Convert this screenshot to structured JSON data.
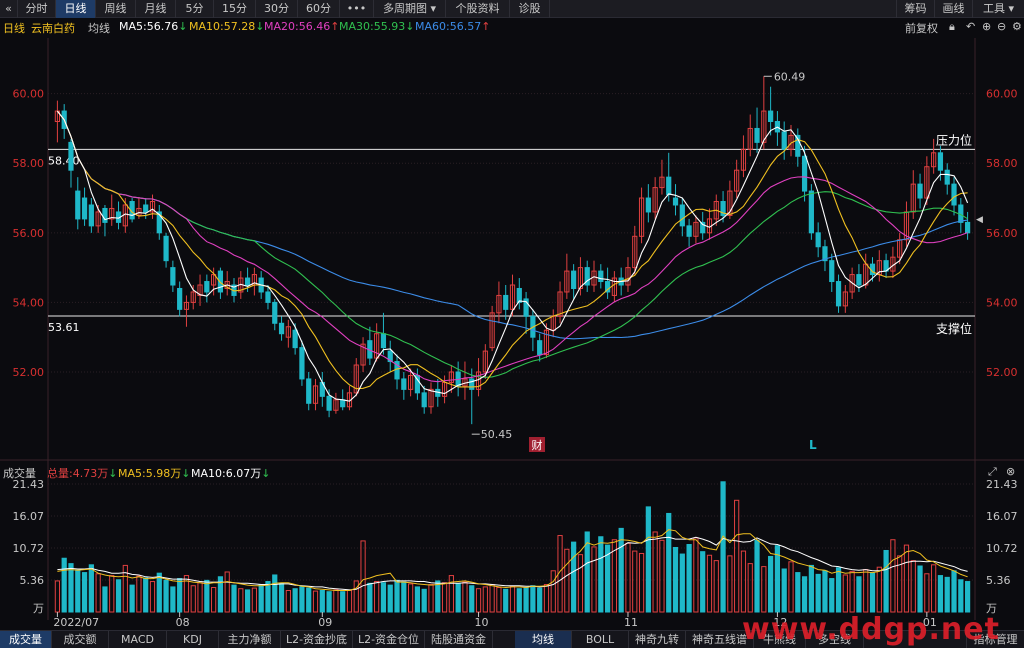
{
  "toolbar": {
    "collapse_icon": "«",
    "periods": [
      "分时",
      "日线",
      "周线",
      "月线",
      "5分",
      "15分",
      "30分",
      "60分",
      "•••",
      "多周期图 ▾",
      "个股资料",
      "诊股"
    ],
    "right": [
      "筹码",
      "画线",
      "工具 ▾"
    ]
  },
  "info": {
    "period": "日线",
    "stock_name": "云南白药",
    "indicator": "均线",
    "ma5": "MA5:56.76",
    "ma5_arrow": "↓",
    "ma10": "MA10:57.28",
    "ma10_arrow": "↓",
    "ma20": "MA20:56.46",
    "ma20_arrow": "↑",
    "ma30": "MA30:55.93",
    "ma30_arrow": "↓",
    "ma60": "MA60:56.57",
    "ma60_arrow": "↑",
    "adjust": "前复权"
  },
  "colors": {
    "up": "#e04040",
    "down": "#1fb8c8",
    "ma5": "#ffffff",
    "ma10": "#f0c020",
    "ma20": "#e040c0",
    "ma30": "#30c050",
    "ma60": "#3c8ce8",
    "axis_text": "#d83030",
    "grid": "#2a1f24"
  },
  "chart_data": [
    {
      "type": "candlestick",
      "title": "日线 云南白药",
      "y_ticks": [
        "60.00",
        "58.00",
        "56.00",
        "54.00",
        "52.00"
      ],
      "ylim": [
        49.7,
        61.6
      ],
      "x_labels": [
        "2022/07",
        "08",
        "09",
        "10",
        "11",
        "12",
        "01",
        "02"
      ],
      "annotations": {
        "high": "60.49",
        "low": "50.45",
        "resistance_value": "58.40",
        "resistance_label": "压力位",
        "support_value": "53.61",
        "support_label": "支撑位",
        "event_marker": "财",
        "l_marker": "L"
      },
      "candles": [
        [
          59.2,
          59.5,
          59.8,
          58.6
        ],
        [
          59.5,
          59.0,
          59.7,
          58.7
        ],
        [
          58.6,
          57.8,
          58.7,
          57.3
        ],
        [
          57.2,
          56.4,
          57.6,
          56.1
        ],
        [
          57.0,
          56.4,
          57.3,
          56.2
        ],
        [
          56.8,
          56.2,
          57.0,
          56.0
        ],
        [
          56.2,
          56.6,
          56.8,
          56.0
        ],
        [
          56.7,
          56.3,
          56.8,
          55.9
        ],
        [
          56.4,
          56.7,
          57.1,
          56.2
        ],
        [
          56.6,
          56.3,
          56.9,
          56.1
        ],
        [
          56.2,
          56.8,
          57.0,
          56.0
        ],
        [
          56.9,
          56.4,
          57.0,
          56.3
        ],
        [
          56.5,
          56.7,
          57.0,
          56.4
        ],
        [
          56.8,
          56.6,
          57.0,
          56.4
        ],
        [
          56.6,
          56.9,
          57.1,
          56.4
        ],
        [
          56.6,
          56.0,
          56.8,
          55.8
        ],
        [
          55.9,
          55.2,
          56.0,
          55.0
        ],
        [
          55.0,
          54.5,
          55.2,
          54.3
        ],
        [
          54.4,
          53.8,
          54.6,
          53.6
        ],
        [
          53.8,
          54.0,
          54.2,
          53.3
        ],
        [
          54.0,
          54.3,
          54.5,
          53.8
        ],
        [
          54.2,
          54.5,
          54.8,
          53.9
        ],
        [
          54.6,
          54.3,
          54.8,
          54.0
        ],
        [
          54.5,
          54.8,
          55.0,
          54.2
        ],
        [
          54.9,
          54.3,
          55.0,
          54.1
        ],
        [
          54.4,
          54.6,
          54.9,
          54.2
        ],
        [
          54.5,
          54.2,
          54.7,
          54.0
        ],
        [
          54.3,
          54.7,
          54.9,
          54.1
        ],
        [
          54.7,
          54.5,
          55.0,
          54.3
        ],
        [
          54.5,
          54.8,
          55.0,
          54.2
        ],
        [
          54.7,
          54.3,
          54.9,
          54.1
        ],
        [
          54.3,
          54.0,
          54.5,
          53.8
        ],
        [
          54.0,
          53.4,
          54.1,
          53.2
        ],
        [
          53.4,
          53.1,
          53.6,
          52.9
        ],
        [
          53.0,
          53.3,
          53.5,
          52.7
        ],
        [
          53.2,
          52.7,
          53.4,
          52.5
        ],
        [
          52.7,
          51.8,
          52.9,
          51.6
        ],
        [
          51.8,
          51.1,
          52.0,
          50.9
        ],
        [
          51.1,
          51.6,
          51.8,
          50.9
        ],
        [
          51.7,
          51.3,
          52.0,
          51.0
        ],
        [
          51.3,
          50.9,
          51.5,
          50.7
        ],
        [
          50.9,
          51.2,
          51.4,
          50.8
        ],
        [
          51.2,
          51.0,
          51.5,
          50.9
        ],
        [
          51.0,
          51.4,
          51.6,
          50.9
        ],
        [
          51.4,
          52.2,
          52.4,
          51.3
        ],
        [
          52.2,
          52.8,
          53.0,
          52.0
        ],
        [
          52.9,
          52.4,
          53.3,
          52.2
        ],
        [
          52.4,
          53.1,
          53.4,
          52.3
        ],
        [
          53.1,
          52.7,
          53.7,
          52.5
        ],
        [
          52.6,
          52.3,
          52.9,
          52.0
        ],
        [
          52.3,
          51.8,
          52.5,
          51.5
        ],
        [
          51.8,
          51.5,
          52.0,
          51.2
        ],
        [
          51.5,
          51.9,
          52.1,
          51.3
        ],
        [
          51.9,
          51.4,
          52.1,
          51.2
        ],
        [
          51.4,
          51.0,
          51.6,
          50.8
        ],
        [
          51.0,
          51.5,
          51.7,
          50.8
        ],
        [
          51.5,
          51.3,
          51.8,
          51.0
        ],
        [
          51.3,
          51.7,
          51.9,
          51.1
        ],
        [
          51.7,
          52.0,
          52.2,
          51.4
        ],
        [
          52.0,
          51.6,
          52.3,
          51.3
        ],
        [
          51.6,
          51.8,
          52.3,
          51.2
        ],
        [
          51.8,
          51.5,
          52.1,
          50.5
        ],
        [
          51.5,
          52.0,
          52.4,
          51.3
        ],
        [
          52.0,
          52.6,
          52.8,
          51.8
        ],
        [
          52.7,
          53.7,
          53.9,
          52.6
        ],
        [
          53.7,
          54.2,
          54.6,
          53.4
        ],
        [
          54.2,
          53.8,
          54.5,
          53.5
        ],
        [
          53.8,
          54.5,
          54.8,
          53.6
        ],
        [
          54.4,
          54.0,
          54.7,
          53.8
        ],
        [
          54.1,
          53.6,
          54.3,
          53.1
        ],
        [
          53.6,
          53.0,
          53.8,
          52.6
        ],
        [
          52.9,
          52.5,
          53.1,
          52.3
        ],
        [
          52.5,
          53.2,
          53.4,
          52.4
        ],
        [
          53.2,
          53.6,
          53.8,
          53.0
        ],
        [
          53.6,
          54.3,
          54.6,
          53.4
        ],
        [
          54.3,
          54.9,
          55.4,
          54.1
        ],
        [
          54.9,
          54.4,
          55.1,
          54.1
        ],
        [
          54.4,
          55.0,
          55.3,
          54.2
        ],
        [
          55.0,
          54.5,
          55.2,
          54.3
        ],
        [
          54.5,
          54.9,
          55.2,
          54.3
        ],
        [
          54.9,
          54.6,
          55.1,
          54.4
        ],
        [
          54.6,
          54.3,
          55.0,
          54.1
        ],
        [
          54.2,
          54.7,
          54.9,
          54.0
        ],
        [
          54.7,
          54.5,
          55.0,
          54.2
        ],
        [
          54.5,
          55.0,
          55.3,
          54.3
        ],
        [
          55.0,
          55.9,
          56.2,
          54.8
        ],
        [
          55.9,
          57.0,
          57.3,
          55.7
        ],
        [
          57.0,
          56.6,
          57.4,
          56.3
        ],
        [
          56.6,
          57.3,
          57.6,
          56.4
        ],
        [
          57.3,
          57.6,
          58.1,
          57.1
        ],
        [
          57.6,
          57.1,
          58.3,
          56.9
        ],
        [
          57.0,
          56.8,
          57.4,
          56.5
        ],
        [
          56.8,
          56.2,
          57.0,
          55.9
        ],
        [
          56.2,
          55.9,
          56.4,
          55.6
        ],
        [
          55.9,
          56.3,
          56.5,
          55.7
        ],
        [
          56.3,
          56.0,
          56.6,
          55.8
        ],
        [
          56.0,
          56.4,
          56.7,
          55.8
        ],
        [
          56.4,
          56.9,
          57.1,
          56.2
        ],
        [
          56.9,
          56.5,
          57.2,
          56.3
        ],
        [
          56.5,
          57.2,
          57.5,
          56.4
        ],
        [
          57.2,
          57.8,
          58.1,
          57.0
        ],
        [
          57.8,
          58.4,
          58.8,
          57.6
        ],
        [
          58.4,
          59.0,
          59.4,
          58.2
        ],
        [
          59.0,
          58.6,
          59.6,
          58.3
        ],
        [
          58.6,
          59.5,
          60.5,
          58.4
        ],
        [
          59.5,
          59.2,
          60.2,
          58.8
        ],
        [
          59.2,
          58.9,
          59.5,
          58.5
        ],
        [
          58.9,
          58.4,
          59.2,
          58.1
        ],
        [
          58.4,
          58.8,
          59.1,
          58.2
        ],
        [
          58.8,
          58.2,
          59.0,
          57.9
        ],
        [
          58.2,
          57.2,
          58.5,
          56.9
        ],
        [
          57.2,
          56.0,
          57.4,
          55.8
        ],
        [
          56.0,
          55.6,
          56.3,
          55.3
        ],
        [
          55.6,
          55.2,
          55.8,
          54.9
        ],
        [
          55.2,
          54.6,
          55.4,
          54.3
        ],
        [
          54.6,
          53.9,
          54.8,
          53.7
        ],
        [
          53.9,
          54.3,
          54.5,
          53.7
        ],
        [
          54.3,
          54.8,
          55.0,
          54.1
        ],
        [
          54.8,
          54.5,
          55.1,
          54.3
        ],
        [
          54.5,
          55.1,
          55.4,
          54.4
        ],
        [
          55.1,
          54.8,
          55.3,
          54.6
        ],
        [
          54.8,
          55.2,
          55.5,
          54.6
        ],
        [
          55.2,
          54.9,
          55.4,
          54.7
        ],
        [
          54.9,
          55.3,
          55.6,
          54.7
        ],
        [
          55.3,
          55.8,
          56.0,
          55.1
        ],
        [
          55.8,
          56.6,
          56.9,
          55.6
        ],
        [
          56.6,
          57.4,
          57.8,
          56.4
        ],
        [
          57.4,
          57.0,
          57.7,
          56.7
        ],
        [
          57.0,
          57.9,
          58.2,
          56.8
        ],
        [
          57.9,
          58.3,
          58.7,
          57.7
        ],
        [
          58.3,
          57.8,
          58.5,
          57.5
        ],
        [
          57.8,
          57.4,
          58.0,
          57.1
        ],
        [
          57.4,
          56.8,
          57.6,
          56.5
        ],
        [
          56.8,
          56.3,
          57.0,
          56.0
        ],
        [
          56.3,
          56.0,
          56.6,
          55.8
        ]
      ]
    },
    {
      "type": "bar",
      "title": "成交量",
      "y_ticks": [
        "21.43",
        "16.07",
        "10.72",
        "5.36",
        "万"
      ],
      "ylim": [
        0,
        21.43
      ],
      "legend": {
        "total_label": "总量:4.73万",
        "total_arrow": "↓",
        "ma5_label": "MA5:5.98万",
        "ma5_arrow": "↓",
        "ma10_label": "MA10:6.07万",
        "ma10_arrow": "↓"
      },
      "values": [
        5.2,
        9.0,
        8.1,
        7.0,
        6.6,
        7.9,
        6.4,
        4.2,
        6.1,
        5.4,
        7.8,
        4.5,
        6.0,
        5.7,
        5.1,
        6.5,
        5.3,
        4.2,
        5.6,
        6.1,
        4.4,
        4.9,
        5.3,
        4.1,
        5.9,
        6.7,
        4.5,
        3.9,
        3.7,
        4.0,
        4.6,
        5.1,
        6.2,
        4.8,
        3.6,
        3.9,
        4.2,
        4.0,
        3.5,
        3.6,
        3.4,
        3.7,
        3.4,
        3.6,
        5.2,
        11.9,
        4.8,
        5.1,
        4.9,
        4.5,
        5.3,
        5.0,
        4.7,
        4.2,
        3.8,
        4.6,
        5.2,
        4.9,
        6.1,
        4.7,
        5.0,
        4.4,
        3.9,
        4.2,
        4.6,
        4.1,
        3.8,
        4.3,
        3.9,
        4.1,
        4.4,
        4.0,
        4.6,
        6.9,
        12.8,
        10.5,
        11.7,
        9.6,
        13.4,
        10.9,
        12.6,
        11.2,
        12.1,
        14.0,
        11.5,
        10.2,
        9.8,
        17.6,
        13.4,
        12.0,
        16.5,
        10.8,
        9.7,
        11.3,
        12.4,
        10.1,
        9.5,
        8.6,
        21.8,
        9.4,
        18.7,
        10.2,
        8.1,
        12.0,
        7.6,
        9.3,
        11.1,
        7.2,
        8.4,
        6.6,
        5.9,
        7.8,
        6.3,
        6.9,
        5.6,
        7.4,
        6.2,
        6.8,
        5.9,
        7.1,
        6.5,
        7.5,
        10.3,
        12.1,
        9.4,
        11.2,
        8.6,
        7.7,
        6.4,
        7.9,
        6.1,
        5.8,
        6.9,
        5.4,
        5.1,
        4.8,
        6.0,
        5.2,
        4.6,
        4.2,
        4.9,
        4.7,
        5.3,
        4.1,
        4.5,
        5.0,
        6.4,
        5.8,
        5.5,
        6.8,
        11.6,
        7.2,
        6.5,
        5.9,
        6.1,
        7.0,
        4.7
      ],
      "ma5": [
        6.8,
        7.0,
        7.1,
        7.0,
        7.1,
        7.2,
        6.5,
        6.2,
        6.0,
        5.9,
        6.0,
        5.7,
        5.9,
        5.6,
        5.6,
        5.8,
        5.5,
        5.2,
        5.1,
        5.2,
        5.0,
        4.9,
        4.7,
        4.9,
        4.9,
        5.1,
        4.9,
        4.7,
        4.5,
        4.4,
        4.4,
        4.5,
        4.8,
        4.9,
        4.9,
        4.6,
        4.3,
        4.2,
        3.9,
        3.8,
        3.7,
        3.6,
        3.6,
        3.6,
        4.0,
        5.4,
        5.7,
        6.1,
        6.3,
        6.5,
        5.0,
        5.0,
        4.9,
        4.7,
        4.6,
        4.5,
        4.6,
        4.7,
        5.0,
        5.1,
        5.2,
        5.0,
        4.7,
        4.6,
        4.4,
        4.2,
        4.1,
        4.2,
        4.2,
        4.1,
        4.3,
        4.3,
        4.4,
        5.1,
        6.8,
        8.0,
        9.2,
        10.2,
        11.6,
        11.2,
        11.6,
        11.5,
        11.7,
        12.1,
        12.0,
        11.8,
        11.5,
        12.5,
        12.5,
        12.8,
        13.8,
        13.6,
        12.5,
        12.1,
        12.1,
        10.9,
        10.6,
        10.4,
        12.7,
        11.6,
        12.9,
        13.1,
        13.1,
        12.1,
        11.2,
        9.8,
        9.6,
        9.2,
        8.7,
        8.2,
        7.9,
        7.6,
        7.1,
        7.0,
        6.5,
        6.8,
        6.5,
        6.6,
        6.6,
        6.7,
        6.6,
        6.8,
        7.5,
        8.7,
        9.2,
        10.1,
        10.3,
        9.8,
        8.7,
        8.4,
        7.7,
        7.3,
        6.9,
        6.3,
        5.9,
        5.6,
        5.5,
        5.3,
        5.1,
        4.8,
        4.9,
        4.8,
        4.9,
        4.7,
        4.7,
        4.8,
        5.1,
        5.2,
        5.5,
        5.9,
        7.0,
        7.3,
        7.5,
        7.2,
        7.4,
        7.3,
        6.4
      ],
      "ma10": [
        7.1,
        7.2,
        7.3,
        7.2,
        7.2,
        7.3,
        7.0,
        6.8,
        6.5,
        6.5,
        6.6,
        6.3,
        6.2,
        5.9,
        5.8,
        5.9,
        5.7,
        5.5,
        5.5,
        5.5,
        5.3,
        5.1,
        5.0,
        5.0,
        5.0,
        5.0,
        4.9,
        4.8,
        4.8,
        4.7,
        4.6,
        4.6,
        4.6,
        4.7,
        4.7,
        4.5,
        4.4,
        4.3,
        4.2,
        4.2,
        4.0,
        3.9,
        3.8,
        3.7,
        3.8,
        4.4,
        4.7,
        4.9,
        5.1,
        5.2,
        5.2,
        5.2,
        5.2,
        5.1,
        5.1,
        4.9,
        4.8,
        4.8,
        4.8,
        4.8,
        4.9,
        4.8,
        4.7,
        4.7,
        4.6,
        4.5,
        4.4,
        4.4,
        4.4,
        4.3,
        4.3,
        4.2,
        4.3,
        4.6,
        5.3,
        6.1,
        6.8,
        7.4,
        8.2,
        8.6,
        9.0,
        9.6,
        10.3,
        10.9,
        11.6,
        11.5,
        11.6,
        12.1,
        12.2,
        12.4,
        12.5,
        12.2,
        12.2,
        12.2,
        12.5,
        12.2,
        11.8,
        11.2,
        12.3,
        12.0,
        11.9,
        11.7,
        11.8,
        12.4,
        11.9,
        11.4,
        11.3,
        10.9,
        10.4,
        10.1,
        9.6,
        9.1,
        8.7,
        8.2,
        7.7,
        7.6,
        7.3,
        7.1,
        7.0,
        7.1,
        6.9,
        6.9,
        7.1,
        7.6,
        7.9,
        8.3,
        8.5,
        8.5,
        8.4,
        8.5,
        8.2,
        7.9,
        7.6,
        7.1,
        6.8,
        6.6,
        6.3,
        6.1,
        5.8,
        5.6,
        5.4,
        5.3,
        5.2,
        5.0,
        5.0,
        5.0,
        5.0,
        5.1,
        5.3,
        5.5,
        6.1,
        6.3,
        6.6,
        6.6,
        6.6,
        6.5,
        6.1
      ]
    }
  ],
  "volume_x_labels": [
    "2022/07",
    "08",
    "09",
    "10",
    "11",
    "12",
    "01",
    "02"
  ],
  "bottom_tabs": [
    "成交量",
    "成交额",
    "MACD",
    "KDJ",
    "主力净额",
    "L2-资金抄底",
    "L2-资金仓位",
    "陆股通资金",
    "均线",
    "BOLL",
    "神奇九转",
    "神奇五线谱",
    "牛熊线",
    "多空线",
    "指标管理"
  ],
  "watermark": "www.ddgp.net"
}
